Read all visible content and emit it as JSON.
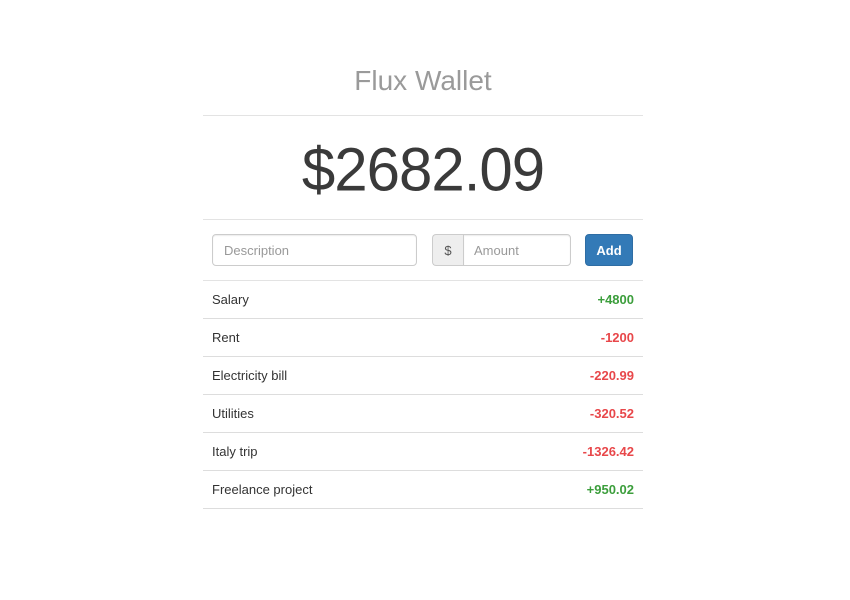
{
  "app": {
    "title": "Flux Wallet",
    "balance": "$2682.09"
  },
  "form": {
    "description_placeholder": "Description",
    "description_value": "",
    "currency_symbol": "$",
    "amount_placeholder": "Amount",
    "amount_value": "",
    "add_label": "Add"
  },
  "colors": {
    "positive": "#3c9e3c",
    "negative": "#e8474a",
    "button": "#337ab7"
  },
  "transactions": [
    {
      "description": "Salary",
      "amount": "+4800",
      "type": "positive"
    },
    {
      "description": "Rent",
      "amount": "-1200",
      "type": "negative"
    },
    {
      "description": "Electricity bill",
      "amount": "-220.99",
      "type": "negative"
    },
    {
      "description": "Utilities",
      "amount": "-320.52",
      "type": "negative"
    },
    {
      "description": "Italy trip",
      "amount": "-1326.42",
      "type": "negative"
    },
    {
      "description": "Freelance project",
      "amount": "+950.02",
      "type": "positive"
    }
  ]
}
